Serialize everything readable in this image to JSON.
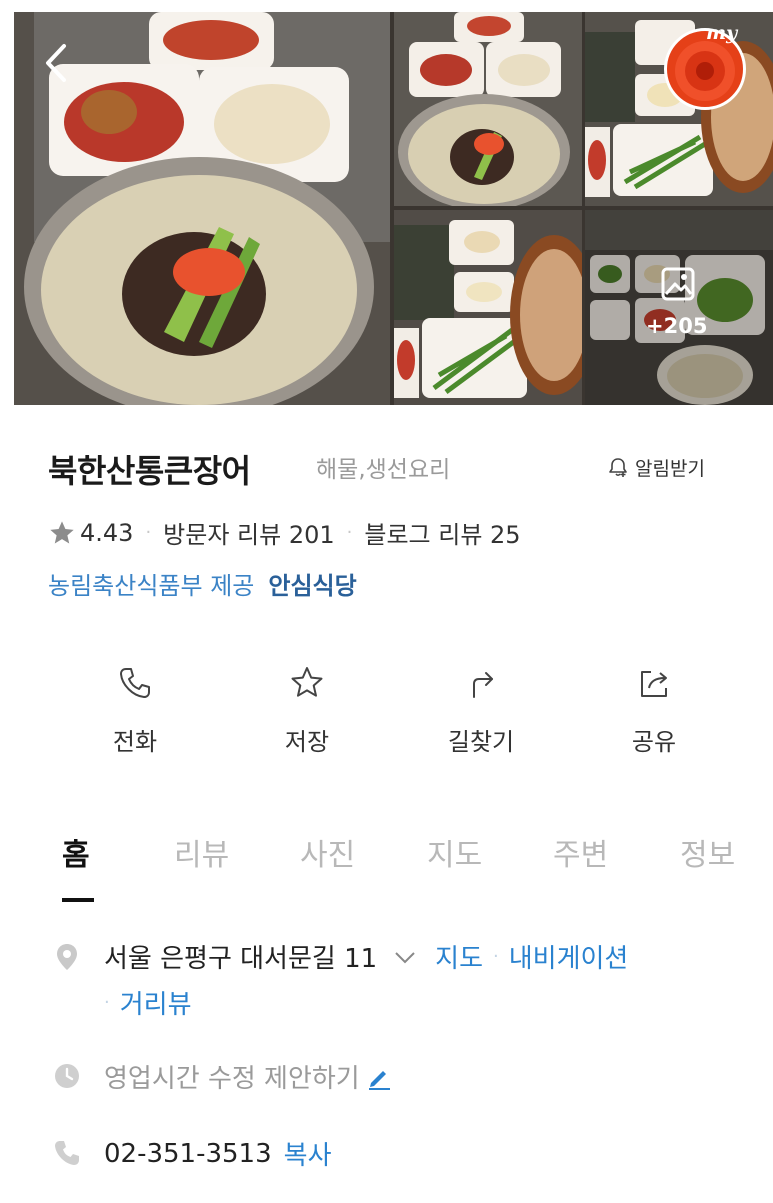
{
  "header": {
    "back_icon": "chevron-left-icon",
    "my_badge": "my",
    "photo_more_count": "+205"
  },
  "place": {
    "name": "북한산통큰장어",
    "category": "해물,생선요리",
    "notify_label": "알림받기"
  },
  "rating": {
    "score": "4.43",
    "visitor_reviews": "방문자 리뷰 201",
    "blog_reviews": "블로그 리뷰 25"
  },
  "certification": {
    "source": "농림축산식품부 제공",
    "name": "안심식당"
  },
  "actions": [
    {
      "label": "전화",
      "icon": "phone-icon"
    },
    {
      "label": "저장",
      "icon": "star-icon"
    },
    {
      "label": "길찾기",
      "icon": "directions-icon"
    },
    {
      "label": "공유",
      "icon": "share-icon"
    }
  ],
  "tabs": [
    {
      "label": "홈",
      "active": true
    },
    {
      "label": "리뷰"
    },
    {
      "label": "사진"
    },
    {
      "label": "지도"
    },
    {
      "label": "주변"
    },
    {
      "label": "정보"
    }
  ],
  "info": {
    "address": "서울 은평구 대서문길 11",
    "map_link": "지도",
    "navigation_link": "내비게이션",
    "streetview_link": "거리뷰",
    "hours_suggest": "영업시간 수정 제안하기",
    "phone": "02-351-3513",
    "copy_label": "복사"
  },
  "colors": {
    "link": "#2a82cf",
    "cert_source": "#3b83c6",
    "muted": "#9a9a9a"
  }
}
